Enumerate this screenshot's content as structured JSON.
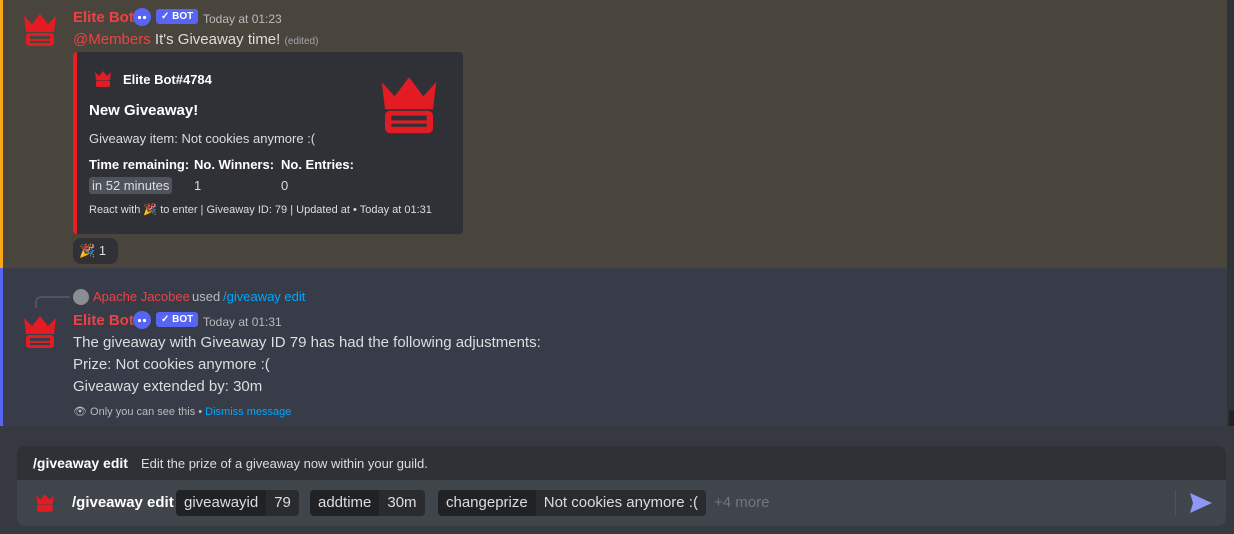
{
  "message1": {
    "author": "Elite Bot",
    "bot_tag": "✓ BOT",
    "timestamp": "Today at 01:23",
    "mention": "@Members",
    "text": "It's Giveaway time!",
    "edited": "(edited)",
    "embed": {
      "author": "Elite Bot#4784",
      "title": "New Giveaway!",
      "description": "Giveaway item: Not cookies anymore :(",
      "fields": [
        {
          "name": "Time remaining:",
          "value": "in 52 minutes"
        },
        {
          "name": "No. Winners:",
          "value": "1"
        },
        {
          "name": "No. Entries:",
          "value": "0"
        }
      ],
      "footer_prefix": "React with",
      "footer_suffix": "to enter | Giveaway ID: 79 | Updated at • Today at 01:31"
    },
    "reaction_count": "1"
  },
  "message2": {
    "reply_user": "Apache Jacobee",
    "reply_used": "used",
    "reply_command": "/giveaway edit",
    "author": "Elite Bot",
    "bot_tag": "✓ BOT",
    "timestamp": "Today at 01:31",
    "lines": [
      "The giveaway with Giveaway ID 79 has had the following adjustments:",
      "Prize: Not cookies anymore :(",
      "Giveaway extended by: 30m"
    ],
    "ephemeral_note": "Only you can see this •",
    "dismiss": "Dismiss message"
  },
  "command_hint": {
    "name": "/giveaway edit",
    "description": "Edit the prize of a giveaway now within your guild."
  },
  "composer": {
    "command": "/giveaway edit",
    "options": [
      {
        "key": "giveawayid",
        "value": "79"
      },
      {
        "key": "addtime",
        "value": "30m"
      },
      {
        "key": "changeprize",
        "value": "Not cookies anymore :("
      }
    ],
    "more": "+4 more"
  },
  "colors": {
    "accent": "#5865f2",
    "bot_red": "#ed1c24",
    "highlight": "#faa81a"
  }
}
